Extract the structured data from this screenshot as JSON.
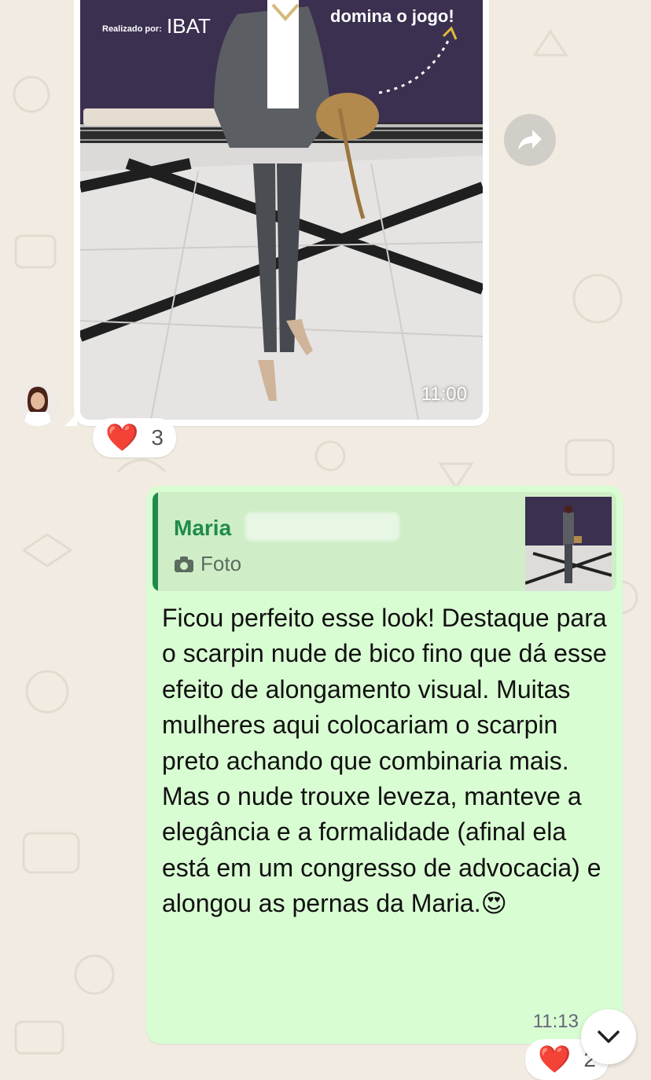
{
  "chat": {
    "incoming_photo": {
      "time": "11:00",
      "banner_tagline": "domina o jogo!",
      "banner_sponsor_label": "Realizado por:",
      "banner_sponsor": "IBAT",
      "reaction_emoji": "❤️",
      "reaction_count": "3"
    },
    "reply": {
      "quoted_author": "Maria",
      "quoted_media_label": "Foto",
      "message": "Ficou perfeito esse look! Destaque para o scarpin nude de bico fino que dá esse efeito de alongamento visual. Muitas mulheres aqui colocariam o scarpin preto achando que combinaria mais. Mas o nude trouxe leveza, manteve a elegância e a formalidade (afinal ela está em um congresso de advocacia) e alongou as pernas da Maria.",
      "message_emoji": "😍",
      "time": "11:13",
      "reaction_emoji": "❤️",
      "reaction_count": "2"
    }
  },
  "icons": {
    "forward": "forward-arrow-icon",
    "camera": "camera-icon",
    "scroll_down": "chevron-down-icon"
  },
  "colors": {
    "outgoing_bubble": "#d9fdd3",
    "incoming_bubble": "#ffffff",
    "quote_accent": "#1f8a4c",
    "heart": "#e0262b",
    "wallpaper": "#f1ebe2"
  }
}
